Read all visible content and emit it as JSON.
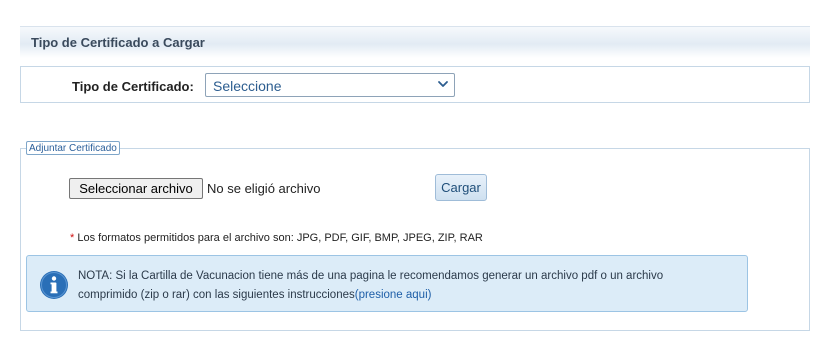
{
  "section": {
    "title": "Tipo de Certificado a Cargar"
  },
  "tipo": {
    "label": "Tipo de Certificado:",
    "selected": "Seleccione"
  },
  "adjuntar": {
    "legend": "Adjuntar Certificado",
    "file_button": "Seleccionar archivo",
    "file_status": "No se eligió archivo",
    "upload_button": "Cargar",
    "formats_asterisk": "*",
    "formats_text": "Los formatos permitidos para el archivo son: JPG, PDF, GIF, BMP, JPEG, ZIP, RAR"
  },
  "info": {
    "icon": "info-icon",
    "text_line1": "NOTA: Si la Cartilla de Vacunacion tiene más de una pagina le recomendamos generar un archivo pdf o un archivo",
    "text_line2": "comprimido (zip o rar) con las siguientes instrucciones",
    "link": "(presione aqui)"
  },
  "colors": {
    "header_text": "#3a4a5c",
    "select_text": "#2c5d8f",
    "legend_text": "#2b5f9a",
    "info_bg": "#dcecf8",
    "info_icon": "#2a6fb7",
    "link": "#1f5fa8",
    "asterisk": "#d01010"
  }
}
